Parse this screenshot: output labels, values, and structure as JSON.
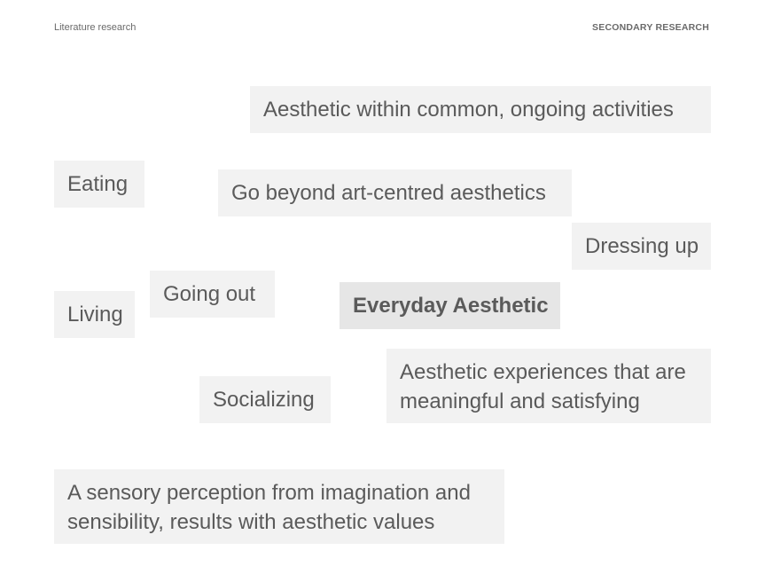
{
  "header": {
    "section": "Literature research",
    "category": "SECONDARY RESEARCH"
  },
  "tags": {
    "common_activities": "Aesthetic within common, ongoing activities",
    "eating": "Eating",
    "beyond_art": "Go beyond art-centred aesthetics",
    "dressing_up": "Dressing up",
    "going_out": "Going out",
    "everyday_aesthetic": "Everyday Aesthetic",
    "living": "Living",
    "meaningful_line1": "Aesthetic experiences that are",
    "meaningful_line2": "meaningful and satisfying",
    "socializing": "Socializing",
    "sensory_line1": "A sensory perception from imagination and",
    "sensory_line2": "sensibility, results with aesthetic values"
  }
}
